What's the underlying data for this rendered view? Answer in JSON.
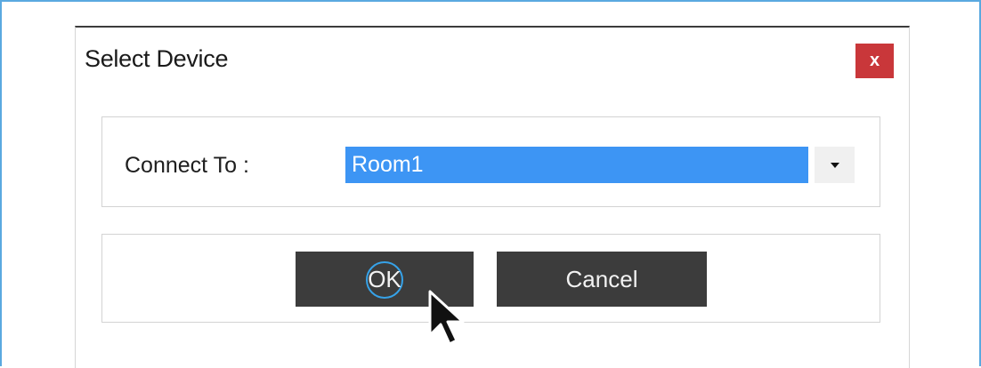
{
  "dialog": {
    "title": "Select Device",
    "close_label": "x"
  },
  "connect": {
    "label": "Connect To :",
    "selected_value": "Room1"
  },
  "buttons": {
    "ok_label": "OK",
    "cancel_label": "Cancel"
  },
  "colors": {
    "frame_border": "#5aa9e0",
    "close_bg": "#c9373a",
    "selection_bg": "#3d95f4",
    "button_bg": "#3c3c3c",
    "focus_ring": "#36a2e8"
  },
  "icons": {
    "close": "close-icon",
    "dropdown": "chevron-down-icon",
    "cursor": "mouse-pointer-icon"
  }
}
